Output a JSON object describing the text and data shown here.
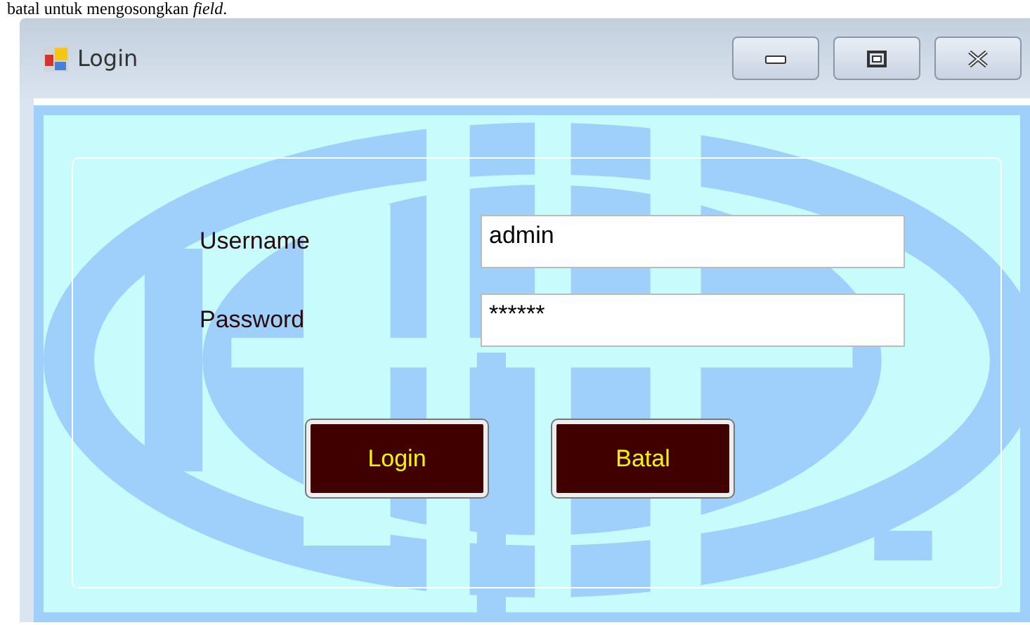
{
  "caption": "batal untuk mengosongkan *field*.",
  "window": {
    "title": "Login"
  },
  "form": {
    "fields": [
      {
        "label": "Username",
        "value": "admin"
      },
      {
        "label": "Password",
        "value": "******"
      }
    ],
    "buttons": [
      "Login",
      "Batal"
    ]
  }
}
